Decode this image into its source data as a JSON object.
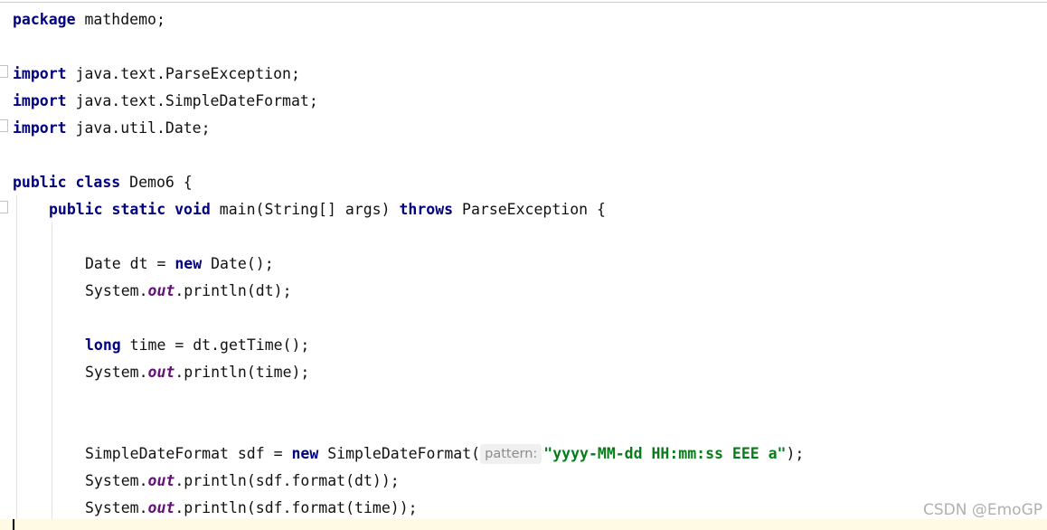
{
  "code": {
    "package_kw": "package",
    "package_name": " mathdemo;",
    "import_kw": "import",
    "imports": [
      " java.text.ParseException;",
      " java.text.SimpleDateFormat;",
      " java.util.Date;"
    ],
    "class_public": "public",
    "class_kw": "class",
    "class_name": " Demo6 {",
    "main_public": "public",
    "main_static": "static",
    "main_void": "void",
    "main_sig": " main(String[] args) ",
    "main_throws": "throws",
    "main_rest": " ParseException {",
    "date_decl_a": "Date dt = ",
    "new_kw": "new",
    "date_decl_b": " Date();",
    "sysout_prefix": "System.",
    "out_field": "out",
    "print_dt": ".println(dt);",
    "long_kw": "long",
    "time_decl": " time = dt.getTime();",
    "print_time": ".println(time);",
    "sdf_decl_a": "SimpleDateFormat sdf = ",
    "sdf_decl_b": " SimpleDateFormat(",
    "param_hint": "pattern:",
    "pattern_string": "\"yyyy-MM-dd HH:mm:ss EEE a\"",
    "sdf_decl_end": ");",
    "print_fmt_dt": ".println(sdf.format(dt));",
    "print_fmt_time": ".println(sdf.format(time));"
  },
  "watermark": "CSDN @EmoGP",
  "colors": {
    "keyword": "#000080",
    "static_field": "#660e7a",
    "string": "#067d17",
    "current_line": "#fffae3"
  }
}
